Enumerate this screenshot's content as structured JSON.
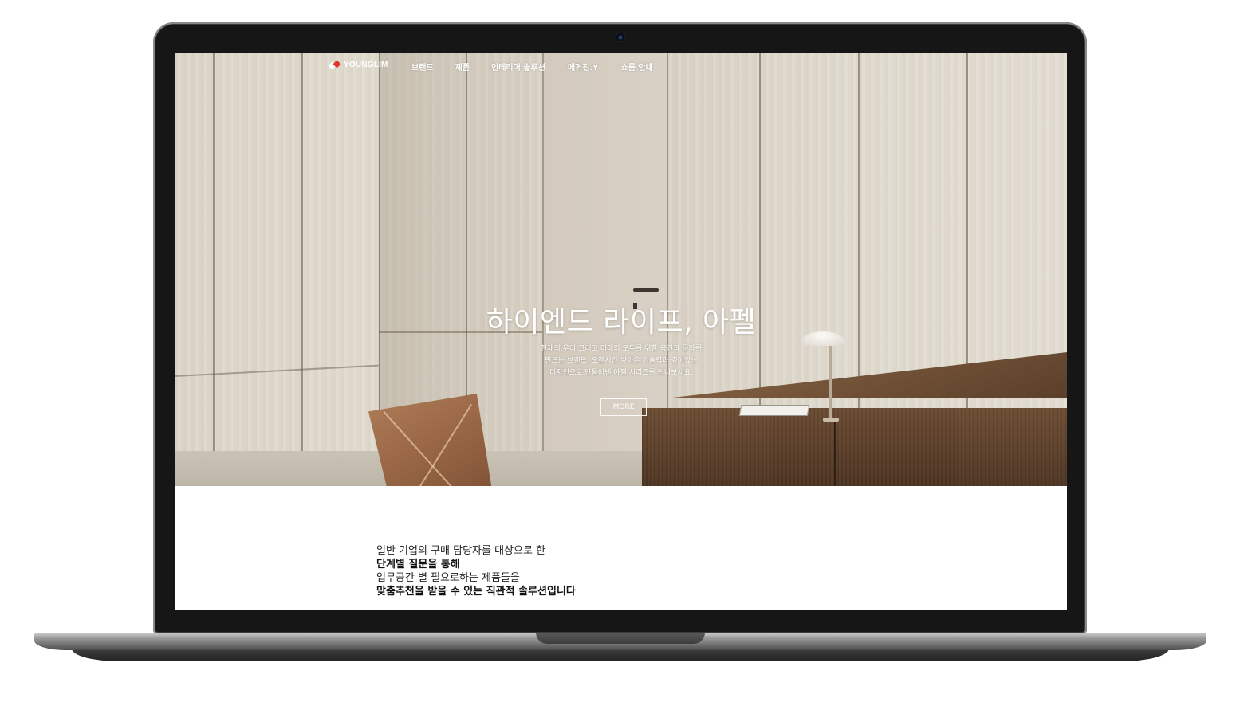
{
  "site": {
    "logo_text": "YOUNGLIM",
    "nav": [
      "브랜드",
      "제품",
      "인테리어 솔루션",
      "메거진.Y",
      "쇼룸 안내"
    ]
  },
  "hero": {
    "title": "하이엔드 라이프, 아펠",
    "desc_line1": "현재의 우리 그리고 미래의 모두를 위한 공간과 문화를",
    "desc_line2": "만드는 브랜드, 오랜시간 쌓아온 기술력과 깊이있는",
    "desc_line3": "디자인으로 만들어낸 아펠 시리즈를 만나보세요.",
    "more_label": "MORE"
  },
  "intro": {
    "line1": "일반 기업의 구매 담당자를 대상으로 한",
    "line2": "단계별 질문을 통해",
    "line3": "업무공간 별 필요로하는 제품들을",
    "line4": "맞춤추천을 받을 수 있는 직관적 솔루션입니다"
  },
  "colors": {
    "accent": "#e0342b",
    "bezel": "#161616",
    "wood": "#6b4b32"
  }
}
